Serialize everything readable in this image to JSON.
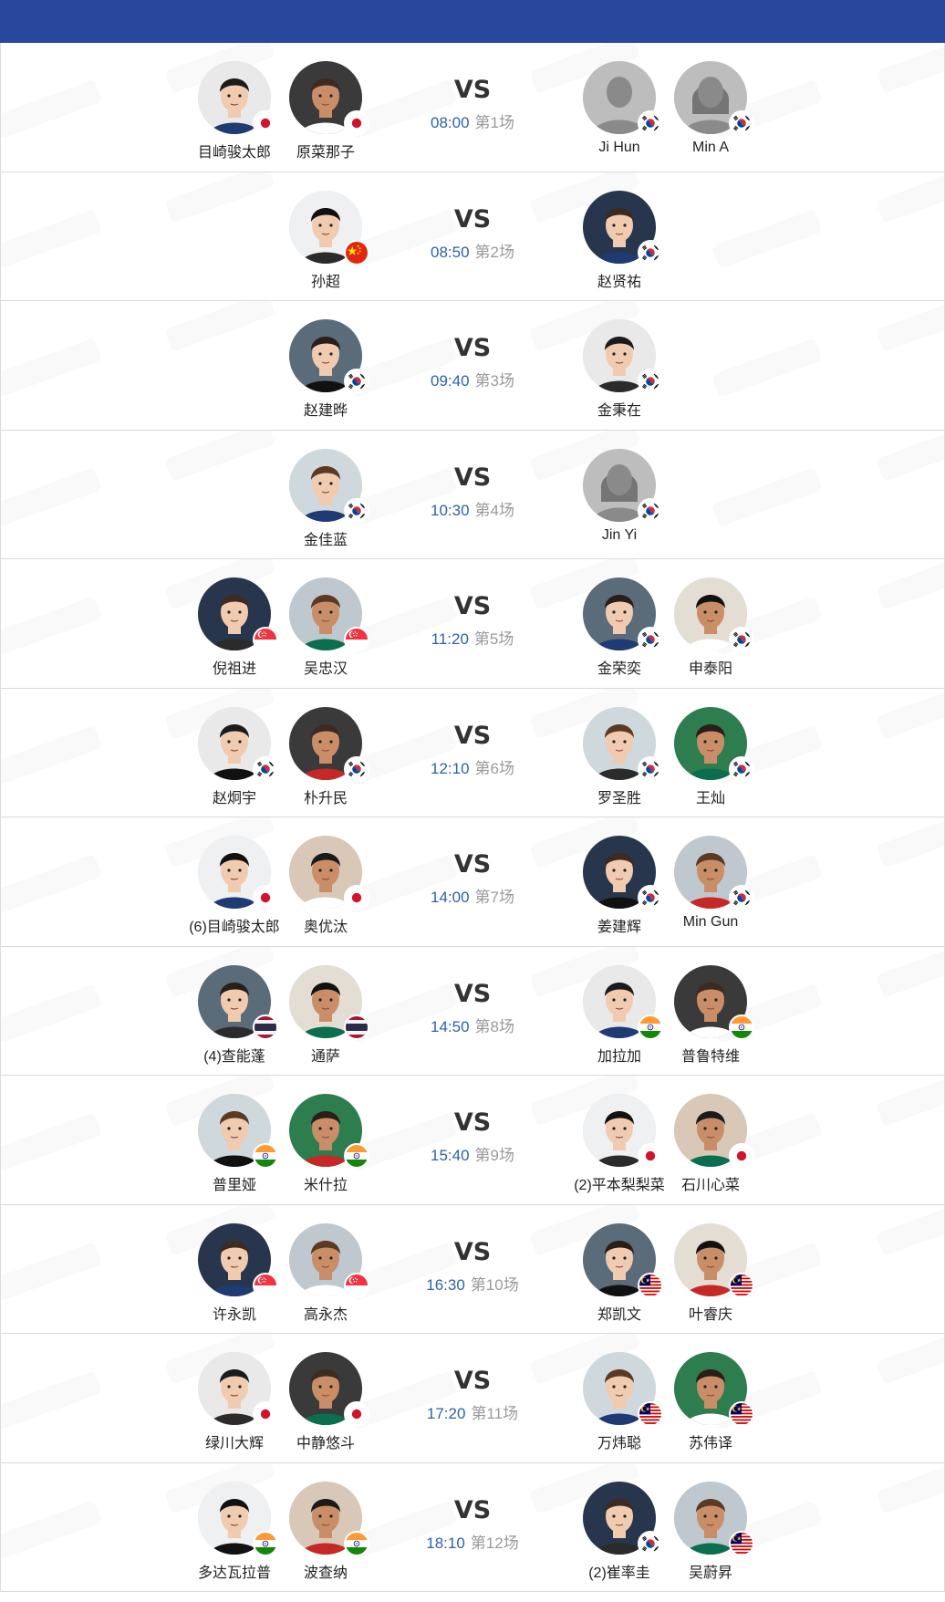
{
  "header": {
    "bar_color": "#27489b"
  },
  "colors": {
    "time": "#2f62a8",
    "match_no": "#9a9a9a",
    "divider": "#d9d9d9"
  },
  "matches": [
    {
      "time": "08:00",
      "match_no": "第1场",
      "vs": "VS",
      "left": [
        {
          "name": "目崎骏太郎",
          "flag": "jp",
          "avatar": "photo"
        },
        {
          "name": "原菜那子",
          "flag": "jp",
          "avatar": "photo"
        }
      ],
      "right": [
        {
          "name": "Ji Hun",
          "flag": "kr",
          "avatar": "placeholder-male"
        },
        {
          "name": "Min A",
          "flag": "kr",
          "avatar": "placeholder-female"
        }
      ]
    },
    {
      "time": "08:50",
      "match_no": "第2场",
      "vs": "VS",
      "left": [
        {
          "name": "孙超",
          "flag": "cn",
          "avatar": "photo"
        }
      ],
      "right": [
        {
          "name": "赵贤祐",
          "flag": "kr",
          "avatar": "photo"
        }
      ]
    },
    {
      "time": "09:40",
      "match_no": "第3场",
      "vs": "VS",
      "left": [
        {
          "name": "赵建晔",
          "flag": "kr",
          "avatar": "photo"
        }
      ],
      "right": [
        {
          "name": "金秉在",
          "flag": "kr",
          "avatar": "photo"
        }
      ]
    },
    {
      "time": "10:30",
      "match_no": "第4场",
      "vs": "VS",
      "left": [
        {
          "name": "金佳蓝",
          "flag": "kr",
          "avatar": "photo"
        }
      ],
      "right": [
        {
          "name": "Jin Yi",
          "flag": "kr",
          "avatar": "placeholder-female"
        }
      ]
    },
    {
      "time": "11:20",
      "match_no": "第5场",
      "vs": "VS",
      "left": [
        {
          "name": "倪祖进",
          "flag": "sg",
          "avatar": "photo"
        },
        {
          "name": "吴忠汉",
          "flag": "sg",
          "avatar": "photo"
        }
      ],
      "right": [
        {
          "name": "金荣奕",
          "flag": "kr",
          "avatar": "photo"
        },
        {
          "name": "申泰阳",
          "flag": "kr",
          "avatar": "photo"
        }
      ]
    },
    {
      "time": "12:10",
      "match_no": "第6场",
      "vs": "VS",
      "left": [
        {
          "name": "赵炯宇",
          "flag": "kr",
          "avatar": "photo"
        },
        {
          "name": "朴升民",
          "flag": "kr",
          "avatar": "photo"
        }
      ],
      "right": [
        {
          "name": "罗圣胜",
          "flag": "kr",
          "avatar": "photo"
        },
        {
          "name": "王灿",
          "flag": "kr",
          "avatar": "photo"
        }
      ]
    },
    {
      "time": "14:00",
      "match_no": "第7场",
      "vs": "VS",
      "left": [
        {
          "name": "(6)目崎骏太郎",
          "flag": "jp",
          "avatar": "photo"
        },
        {
          "name": "奥优汰",
          "flag": "jp",
          "avatar": "photo"
        }
      ],
      "right": [
        {
          "name": "姜建辉",
          "flag": "kr",
          "avatar": "photo"
        },
        {
          "name": "Min Gun",
          "flag": "kr",
          "avatar": "photo"
        }
      ]
    },
    {
      "time": "14:50",
      "match_no": "第8场",
      "vs": "VS",
      "left": [
        {
          "name": "(4)查能蓬",
          "flag": "th",
          "avatar": "photo"
        },
        {
          "name": "通萨",
          "flag": "th",
          "avatar": "photo"
        }
      ],
      "right": [
        {
          "name": "加拉加",
          "flag": "in",
          "avatar": "photo"
        },
        {
          "name": "普鲁特维",
          "flag": "in",
          "avatar": "photo"
        }
      ]
    },
    {
      "time": "15:40",
      "match_no": "第9场",
      "vs": "VS",
      "left": [
        {
          "name": "普里娅",
          "flag": "in",
          "avatar": "photo"
        },
        {
          "name": "米什拉",
          "flag": "in",
          "avatar": "photo"
        }
      ],
      "right": [
        {
          "name": "(2)平本梨梨菜",
          "flag": "jp",
          "avatar": "photo"
        },
        {
          "name": "石川心菜",
          "flag": "jp",
          "avatar": "photo"
        }
      ]
    },
    {
      "time": "16:30",
      "match_no": "第10场",
      "vs": "VS",
      "left": [
        {
          "name": "许永凯",
          "flag": "sg",
          "avatar": "photo"
        },
        {
          "name": "高永杰",
          "flag": "sg",
          "avatar": "photo"
        }
      ],
      "right": [
        {
          "name": "郑凯文",
          "flag": "my",
          "avatar": "photo"
        },
        {
          "name": "叶睿庆",
          "flag": "my",
          "avatar": "photo"
        }
      ]
    },
    {
      "time": "17:20",
      "match_no": "第11场",
      "vs": "VS",
      "left": [
        {
          "name": "绿川大辉",
          "flag": "jp",
          "avatar": "photo"
        },
        {
          "name": "中静悠斗",
          "flag": "jp",
          "avatar": "photo"
        }
      ],
      "right": [
        {
          "name": "万炜聪",
          "flag": "my",
          "avatar": "photo"
        },
        {
          "name": "苏伟译",
          "flag": "my",
          "avatar": "photo"
        }
      ]
    },
    {
      "time": "18:10",
      "match_no": "第12场",
      "vs": "VS",
      "left": [
        {
          "name": "多达瓦拉普",
          "flag": "in",
          "avatar": "photo"
        },
        {
          "name": "波查纳",
          "flag": "in",
          "avatar": "photo"
        }
      ],
      "right": [
        {
          "name": "(2)崔率圭",
          "flag": "kr",
          "avatar": "photo"
        },
        {
          "name": "吴蔚昇",
          "flag": "my",
          "avatar": "photo"
        }
      ]
    }
  ]
}
